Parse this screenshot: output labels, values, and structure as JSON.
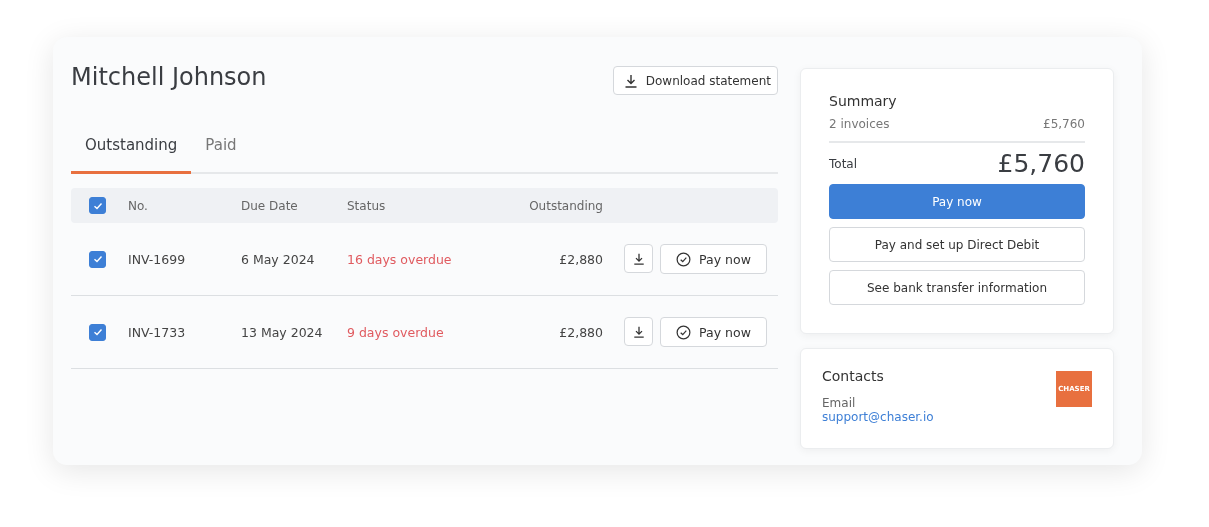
{
  "customer": {
    "name": "Mitchell Johnson"
  },
  "download_statement": {
    "label": "Download statement"
  },
  "tabs": [
    {
      "label": "Outstanding",
      "selected": true
    },
    {
      "label": "Paid",
      "selected": false
    }
  ],
  "table": {
    "select_all": {
      "checked": true
    },
    "columns": [
      "No.",
      "Due Date",
      "Status",
      "Outstanding"
    ],
    "rows": [
      {
        "checked": true,
        "number": "INV-1699",
        "due_date": "6 May 2024",
        "status": "16 days overdue",
        "outstanding": "£2,880",
        "pay_label": "Pay now"
      },
      {
        "checked": true,
        "number": "INV-1733",
        "due_date": "13 May 2024",
        "status": "9 days overdue",
        "outstanding": "£2,880",
        "pay_label": "Pay now"
      }
    ]
  },
  "summary": {
    "title": "Summary",
    "count_label": "2 invoices",
    "count_amount": "£5,760",
    "total_label": "Total",
    "total": "£5,760",
    "buttons": [
      {
        "label": "Pay now",
        "kind": "primary"
      },
      {
        "label": "Pay and set up Direct Debit",
        "kind": "secondary"
      },
      {
        "label": "See bank transfer information",
        "kind": "secondary"
      }
    ]
  },
  "contacts": {
    "title": "Contacts",
    "email_label": "Email",
    "email": "support@chaser.io",
    "logo": "CHASER"
  }
}
